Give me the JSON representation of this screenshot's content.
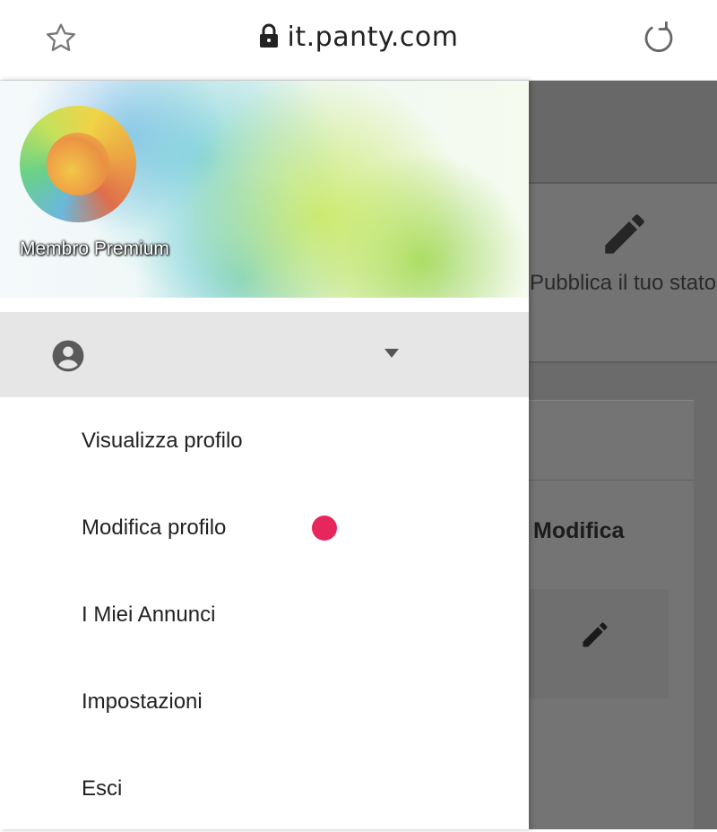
{
  "browser": {
    "url": "it.panty.com",
    "icons": {
      "favorite": "star-icon",
      "secure": "lock-icon",
      "reload": "refresh-icon"
    }
  },
  "drawer": {
    "header": {
      "membership": "Membro Premium"
    },
    "account": {
      "icon": "account-circle-icon",
      "expander": "caret-down-icon"
    },
    "menu": [
      {
        "label": "Visualizza profilo"
      },
      {
        "label": "Modifica profilo",
        "badge": true
      },
      {
        "label": "I Miei Annunci"
      },
      {
        "label": "Impostazioni"
      },
      {
        "label": "Esci"
      }
    ],
    "badge_color": "#e8265e"
  },
  "background_page": {
    "status_button": "Pubblica il tuo stato",
    "section_title": "Modifica",
    "icons": {
      "publish": "pencil-icon",
      "edit": "pencil-icon"
    }
  }
}
